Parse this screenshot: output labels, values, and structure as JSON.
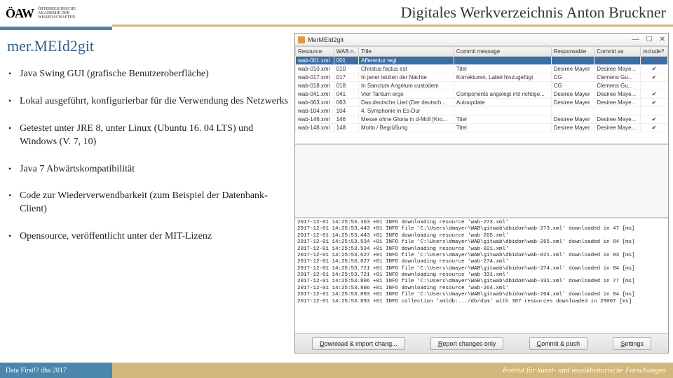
{
  "header": {
    "logo_main": "ÖAW",
    "logo_sub": "ÖSTERREICHISCHE\nAKADEMIE DER\nWISSENSCHAFTEN",
    "title": "Digitales Werkverzeichnis Anton Bruckner"
  },
  "slide": {
    "heading": "mer.MEId2git",
    "bullets": [
      "Java Swing GUI (grafische Benutzeroberfläche)",
      "Lokal ausgeführt, konfigurierbar für die Verwendung des Netzwerks",
      "Getestet unter JRE 8, unter Linux (Ubuntu 16. 04 LTS) und Windows (V. 7, 10)",
      "Java 7 Abwärtskompatibilität",
      "Code zur Wiederverwendbarkeit (zum Beispiel der Datenbank-Client)",
      "Opensource, veröffentlicht unter der MIT-Lizenz"
    ]
  },
  "window": {
    "title": "MerMEId2git",
    "controls": {
      "min": "—",
      "max": "☐",
      "close": "✕"
    },
    "columns": [
      "Resource",
      "WAB n.",
      "Title",
      "Commit message",
      "Responsable",
      "Commit as",
      "Include?"
    ],
    "rows": [
      {
        "sel": true,
        "c": [
          "wab-001.xml",
          "001",
          "Afferentur regi",
          "",
          "",
          "",
          ""
        ]
      },
      {
        "sel": false,
        "c": [
          "wab-010.xml",
          "010",
          "Christus factus est",
          "Titel",
          "Desiree Mayer",
          "Desiree Maye...",
          "✔"
        ]
      },
      {
        "sel": false,
        "c": [
          "wab-017.xml",
          "017",
          "In jener letzten der Nächte",
          "Korrekturen, Label hinzugefügt",
          "CG",
          "Clemens Gu...",
          "✔"
        ]
      },
      {
        "sel": false,
        "c": [
          "wab-018.xml",
          "018",
          "In Sanctum Angelum custodem",
          "",
          "CG",
          "Clemens Gu...",
          ""
        ]
      },
      {
        "sel": false,
        "c": [
          "wab-041.xml",
          "041",
          "Vier Tantum ergo",
          "Components angelegt mit richtige...",
          "Desiree Mayer",
          "Desiree Maye...",
          "✔"
        ]
      },
      {
        "sel": false,
        "c": [
          "wab-063.xml",
          "063",
          "Das deutsche Lied (Der deutsch...",
          "Autoupdate",
          "Desiree Mayer",
          "Desiree Maye...",
          "✔"
        ]
      },
      {
        "sel": false,
        "c": [
          "wab-104.xml",
          "104",
          "4. Symphonie in Es-Dur",
          "",
          "",
          "",
          ""
        ]
      },
      {
        "sel": false,
        "c": [
          "wab-146.xml",
          "146",
          "Messe ohne Gloria in d-Moll [Kro...",
          "Titel",
          "Desiree Mayer",
          "Desiree Maye...",
          "✔"
        ]
      },
      {
        "sel": false,
        "c": [
          "wab-148.xml",
          "148",
          "Motto / Begrüßung",
          "Titel",
          "Desiree Mayer",
          "Desiree Maye...",
          "✔"
        ]
      }
    ],
    "log": [
      "2017-12-01 14:25:53.363 +01 INFO downloading resource 'wab-273.xml'",
      "2017-12-01 14:25:53.443 +01 INFO file 'C:\\Users\\dmayer\\WAB\\gitwab\\dbidom\\wab-273.xml' downloaded in 47 [ms]",
      "2017-12-01 14:25:53.443 +01 INFO downloading resource 'wab-265.xml'",
      "2017-12-01 14:25:53.534 +01 INFO file 'C:\\Users\\dmayer\\WAB\\gitwab\\dbidom\\wab-265.xml' downloaded in 84 [ms]",
      "2017-12-01 14:25:53.534 +01 INFO downloading resource 'wab-021.xml'",
      "2017-12-01 14:25:53.627 +01 INFO file 'C:\\Users\\dmayer\\WAB\\gitwab\\dbidom\\wab-021.xml' downloaded in 83 [ms]",
      "2017-12-01 14:25:53.627 +01 INFO downloading resource 'wab-274.xml'",
      "2017-12-01 14:25:53.721 +01 INFO file 'C:\\Users\\dmayer\\WAB\\gitwab\\dbidom\\wab-274.xml' downloaded in 84 [ms]",
      "2017-12-01 14:25:53.721 +01 INFO downloading resource 'wab-331.xml'",
      "2017-12-01 14:25:53.806 +01 INFO file 'C:\\Users\\dmayer\\WAB\\gitwab\\dbidom\\wab-331.xml' downloaded in 77 [ms]",
      "2017-12-01 14:25:53.806 +01 INFO downloading resource 'wab-264.xml'",
      "2017-12-01 14:25:53.893 +01 INFO file 'C:\\Users\\dmayer\\WAB\\gitwab\\dbidom\\wab-264.xml' downloaded in 84 [ms]",
      "2017-12-01 14:25:53.893 +01 INFO collection 'xmldb:.../db/dom' with 307 resources downloaded in 29007 [ms]"
    ],
    "buttons": {
      "download": "Download & import chang...",
      "report": "Report changes only",
      "commit": "Commit & push",
      "settings": "Settings"
    }
  },
  "footer": {
    "left": "Data First!? dha 2017",
    "right": "Institut für kunst- und musikhistorische Forschungen"
  }
}
